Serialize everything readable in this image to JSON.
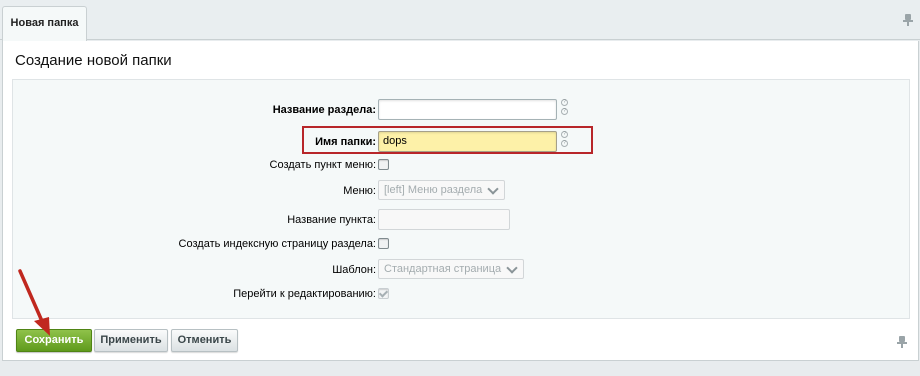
{
  "tab": {
    "label": "Новая папка"
  },
  "page": {
    "title": "Создание новой папки"
  },
  "form": {
    "section_name": {
      "label": "Название раздела:",
      "value": ""
    },
    "folder_name": {
      "label": "Имя папки:",
      "value": "dops"
    },
    "create_menu_item": {
      "label": "Создать пункт меню:",
      "checked": false
    },
    "menu": {
      "label": "Меню:",
      "value": "[left] Меню раздела"
    },
    "item_name": {
      "label": "Название пункта:",
      "value": ""
    },
    "create_index_page": {
      "label": "Создать индексную страницу раздела:",
      "checked": false
    },
    "template": {
      "label": "Шаблон:",
      "value": "Стандартная страница"
    },
    "go_to_edit": {
      "label": "Перейти к редактированию:",
      "checked": true
    }
  },
  "buttons": {
    "save": "Сохранить",
    "apply": "Применить",
    "cancel": "Отменить"
  },
  "colors": {
    "save_green": "#6aa526",
    "highlight_red": "#b8262a",
    "arrow_red": "#c0281f"
  }
}
